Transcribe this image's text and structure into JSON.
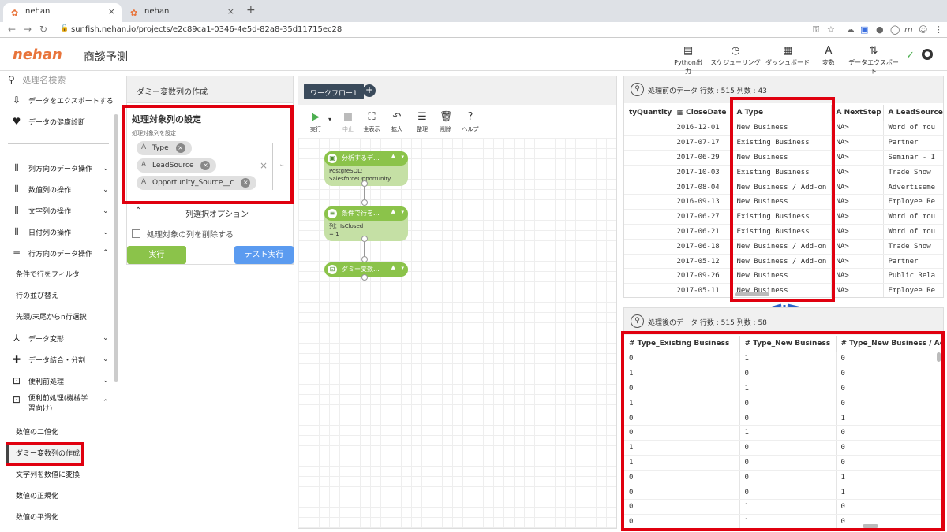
{
  "browser": {
    "tabs": [
      {
        "title": "nehan"
      },
      {
        "title": "nehan"
      }
    ],
    "url": "sunfish.nehan.io/projects/e2c89ca1-0346-4e5d-82a8-35d11715ec28"
  },
  "app": {
    "logo": "nehan",
    "title": "商談予測",
    "header_buttons": [
      {
        "label": "Python出力"
      },
      {
        "label": "スケジューリング"
      },
      {
        "label": "ダッシュボード"
      },
      {
        "label": "変数"
      },
      {
        "label": "データエクスポート"
      }
    ]
  },
  "sidebar": {
    "search_placeholder": "処理名検索",
    "top_items": [
      {
        "label": "データをエクスポートする"
      },
      {
        "label": "データの健康診断"
      }
    ],
    "categories": [
      {
        "label": "列方向のデータ操作"
      },
      {
        "label": "数値列の操作"
      },
      {
        "label": "文字列の操作"
      },
      {
        "label": "日付列の操作"
      },
      {
        "label": "行方向のデータ操作"
      }
    ],
    "row_subitems": [
      {
        "label": "条件で行をフィルタ"
      },
      {
        "label": "行の並び替え"
      },
      {
        "label": "先頭/末尾からn行選択"
      }
    ],
    "categories2": [
      {
        "label": "データ変形"
      },
      {
        "label": "データ結合・分割"
      },
      {
        "label": "便利前処理"
      },
      {
        "label": "便利前処理(機械学習向け)"
      }
    ],
    "ml_subitems": [
      {
        "label": "数値の二値化"
      },
      {
        "label": "ダミー変数列の作成"
      },
      {
        "label": "文字列を数値に変換"
      },
      {
        "label": "数値の正規化"
      },
      {
        "label": "数値の平滑化"
      }
    ]
  },
  "settings": {
    "panel_title": "ダミー変数列の作成",
    "section_title": "処理対象列の設定",
    "field_label": "処理対象列を設定",
    "chips": [
      {
        "label": "Type"
      },
      {
        "label": "LeadSource"
      },
      {
        "label": "Opportunity_Source__c"
      }
    ],
    "options_title": "列選択オプション",
    "delete_checkbox": "処理対象の列を削除する",
    "run_button": "実行",
    "test_button": "テスト実行"
  },
  "workflow": {
    "tab": "ワークフロー1",
    "tools": [
      {
        "label": "実行"
      },
      {
        "label": "中止"
      },
      {
        "label": "全表示"
      },
      {
        "label": "拡大"
      },
      {
        "label": "整理"
      },
      {
        "label": "削除"
      },
      {
        "label": "ヘルプ"
      }
    ],
    "nodes": [
      {
        "title": "分析するデ...",
        "body1": "PostgreSQL:",
        "body2": "SalesforceOpportunity"
      },
      {
        "title": "条件で行を...",
        "body1": "列：IsClosed",
        "body2": "= 1"
      },
      {
        "title": "ダミー変数..."
      }
    ]
  },
  "before": {
    "title": "処理前のデータ",
    "meta": "行数 : 515 列数 : 43",
    "columns": [
      "tyQuantity",
      "CloseDate",
      "Type",
      "NextStep",
      "LeadSource"
    ],
    "rows": [
      [
        "",
        "2016-12-01",
        "New Business",
        "NA>",
        "Word of mou"
      ],
      [
        "",
        "2017-07-17",
        "Existing Business",
        "NA>",
        "Partner"
      ],
      [
        "",
        "2017-06-29",
        "New Business",
        "NA>",
        "Seminar - I"
      ],
      [
        "",
        "2017-10-03",
        "Existing Business",
        "NA>",
        "Trade Show"
      ],
      [
        "",
        "2017-08-04",
        "New Business / Add-on",
        "NA>",
        "Advertiseme"
      ],
      [
        "",
        "2016-09-13",
        "New Business",
        "NA>",
        "Employee Re"
      ],
      [
        "",
        "2017-06-27",
        "Existing Business",
        "NA>",
        "Word of mou"
      ],
      [
        "",
        "2017-06-21",
        "Existing Business",
        "NA>",
        "Word of mou"
      ],
      [
        "",
        "2017-06-18",
        "New Business / Add-on",
        "NA>",
        "Trade Show"
      ],
      [
        "",
        "2017-05-12",
        "New Business / Add-on",
        "NA>",
        "Partner"
      ],
      [
        "",
        "2017-09-26",
        "New Business",
        "NA>",
        "Public Rela"
      ],
      [
        "",
        "2017-05-11",
        "New Business",
        "NA>",
        "Employee Re"
      ]
    ]
  },
  "after": {
    "title": "処理後のデータ",
    "meta": "行数 : 515 列数 : 58",
    "columns": [
      "# Type_Existing Business",
      "# Type_New Business",
      "# Type_New Business / Ad"
    ],
    "rows": [
      [
        "0",
        "1",
        "0"
      ],
      [
        "1",
        "0",
        "0"
      ],
      [
        "0",
        "1",
        "0"
      ],
      [
        "1",
        "0",
        "0"
      ],
      [
        "0",
        "0",
        "1"
      ],
      [
        "0",
        "1",
        "0"
      ],
      [
        "1",
        "0",
        "0"
      ],
      [
        "1",
        "0",
        "0"
      ],
      [
        "0",
        "0",
        "1"
      ],
      [
        "0",
        "0",
        "1"
      ],
      [
        "0",
        "1",
        "0"
      ],
      [
        "0",
        "1",
        "0"
      ]
    ]
  },
  "colors": {
    "highlight": "#e0000f",
    "arrow": "#2a62c9",
    "run_button": "#8bc34a",
    "test_button": "#5b9bf0",
    "node_header": "#8bc34a"
  }
}
